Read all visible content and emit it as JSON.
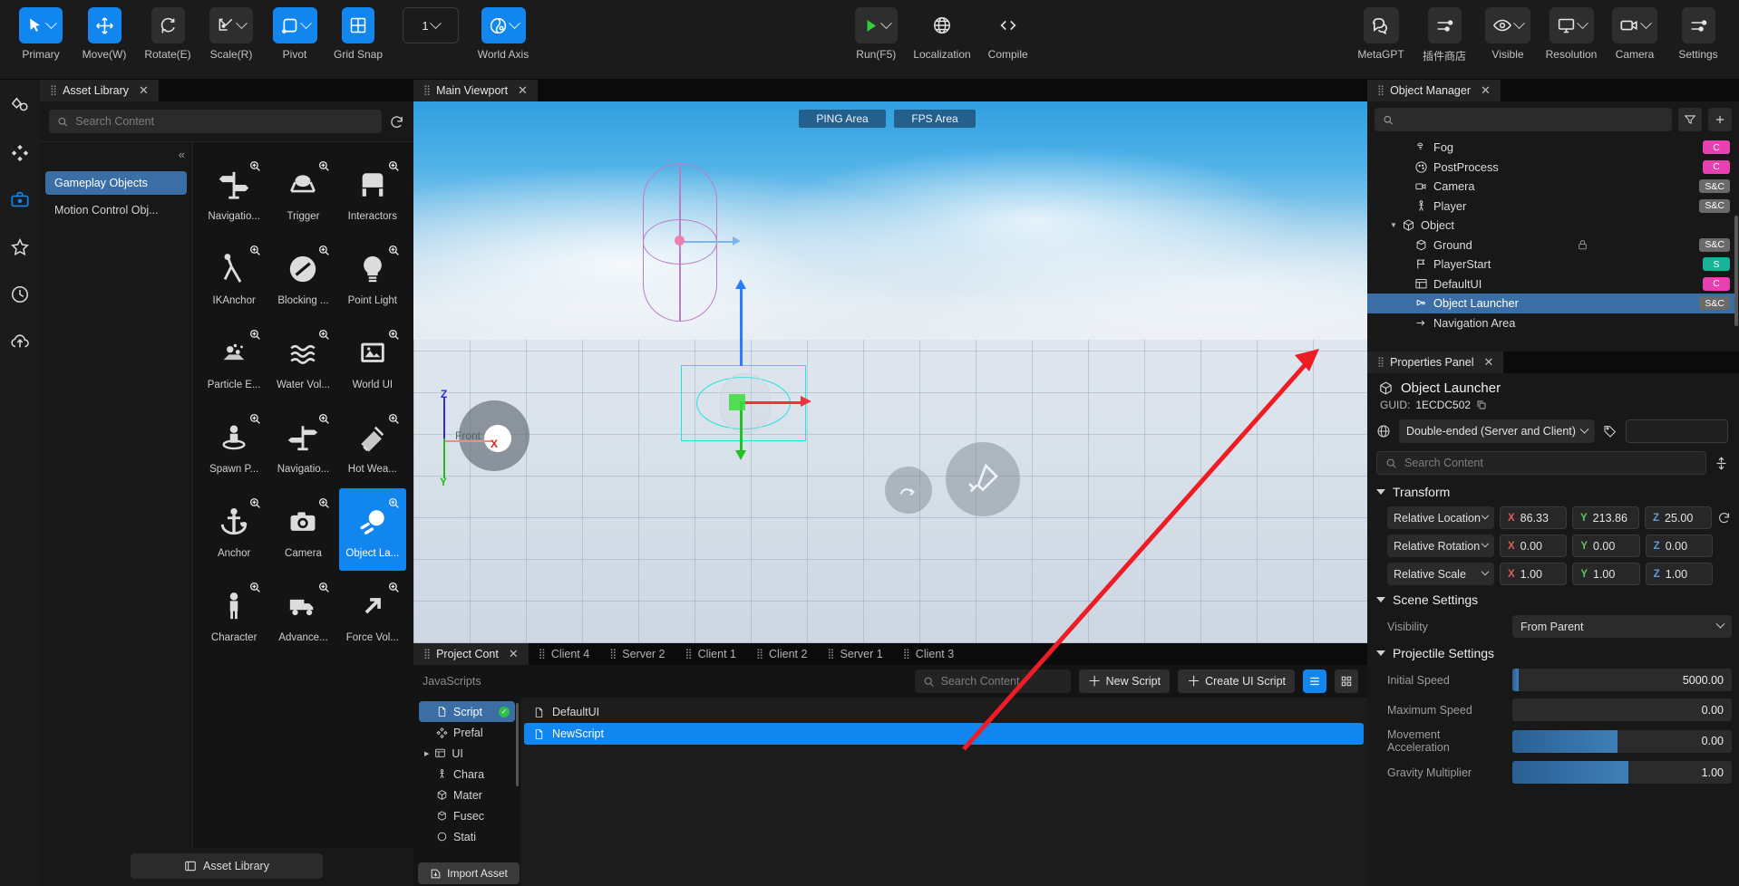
{
  "toolbar": {
    "left_items": [
      {
        "label": "Primary",
        "icon": "cursor-icon",
        "style": "accent",
        "chevron": true
      },
      {
        "label": "Move(W)",
        "icon": "move-icon",
        "style": "accent",
        "chevron": false
      },
      {
        "label": "Rotate(E)",
        "icon": "rotate-icon",
        "style": "dark",
        "chevron": false
      },
      {
        "label": "Scale(R)",
        "icon": "scale-icon",
        "style": "dark",
        "chevron": true
      },
      {
        "label": "Pivot",
        "icon": "pivot-icon",
        "style": "accent",
        "chevron": true
      },
      {
        "label": "Grid Snap",
        "icon": "grid-icon",
        "style": "accent",
        "chevron": false
      }
    ],
    "grid_value": "1",
    "world_axis": {
      "label": "World Axis",
      "icon": "globe-axis-icon"
    },
    "center_items": [
      {
        "label": "Run(F5)",
        "icon": "play-icon",
        "chevron": true
      },
      {
        "label": "Localization",
        "icon": "globe-icon",
        "chevron": false
      },
      {
        "label": "Compile",
        "icon": "code-icon",
        "chevron": false
      }
    ],
    "right_items": [
      {
        "label": "MetaGPT",
        "icon": "chat-bubbles-icon",
        "chevron": false
      },
      {
        "label": "插件商店",
        "icon": "sliders-icon",
        "chevron": false
      },
      {
        "label": "Visible",
        "icon": "eye-icon",
        "chevron": true
      },
      {
        "label": "Resolution",
        "icon": "monitor-icon",
        "chevron": true
      },
      {
        "label": "Camera",
        "icon": "video-icon",
        "chevron": true
      },
      {
        "label": "Settings",
        "icon": "sliders-icon",
        "chevron": false
      }
    ]
  },
  "left_rail": [
    {
      "name": "shapes-icon",
      "active": false
    },
    {
      "name": "diamond-grid-icon",
      "active": false
    },
    {
      "name": "toolbox-icon",
      "active": true
    },
    {
      "name": "star-icon",
      "active": false
    },
    {
      "name": "clock-icon",
      "active": false
    },
    {
      "name": "cloud-upload-icon",
      "active": false
    }
  ],
  "asset_library": {
    "tab_title": "Asset Library",
    "search_placeholder": "Search Content",
    "search_value": "",
    "categories": [
      {
        "label": "Gameplay Objects",
        "selected": true
      },
      {
        "label": "Motion Control Obj...",
        "selected": false
      }
    ],
    "assets": [
      {
        "label": "Navigatio...",
        "icon": "signpost-icon",
        "selected": false
      },
      {
        "label": "Trigger",
        "icon": "trigger-dome-icon",
        "selected": false
      },
      {
        "label": "Interactors",
        "icon": "chair-icon",
        "selected": false
      },
      {
        "label": "IKAnchor",
        "icon": "ik-anchor-icon",
        "selected": false
      },
      {
        "label": "Blocking ...",
        "icon": "no-entry-icon",
        "selected": false
      },
      {
        "label": "Point Light",
        "icon": "lightbulb-icon",
        "selected": false
      },
      {
        "label": "Particle E...",
        "icon": "particle-icon",
        "selected": false
      },
      {
        "label": "Water Vol...",
        "icon": "water-icon",
        "selected": false
      },
      {
        "label": "World UI",
        "icon": "image-ui-icon",
        "selected": false
      },
      {
        "label": "Spawn P...",
        "icon": "spawn-point-icon",
        "selected": false
      },
      {
        "label": "Navigatio...",
        "icon": "signpost-m-icon",
        "selected": false
      },
      {
        "label": "Hot Wea...",
        "icon": "hot-weapon-icon",
        "selected": false
      },
      {
        "label": "Anchor",
        "icon": "anchor-icon",
        "selected": false
      },
      {
        "label": "Camera",
        "icon": "camera-icon",
        "selected": false
      },
      {
        "label": "Object La...",
        "icon": "object-launcher-icon",
        "selected": true
      },
      {
        "label": "Character",
        "icon": "character-icon",
        "selected": false
      },
      {
        "label": "Advance...",
        "icon": "truck-icon",
        "selected": false
      },
      {
        "label": "Force Vol...",
        "icon": "force-arrow-icon",
        "selected": false
      }
    ],
    "footer_button": "Asset Library"
  },
  "viewport": {
    "tab_title": "Main Viewport",
    "badges": [
      "PING Area",
      "FPS Area"
    ],
    "axis_labels": {
      "x": "X",
      "y": "Y",
      "z": "Z",
      "front": "Front"
    }
  },
  "object_manager": {
    "tab_title": "Object Manager",
    "search_placeholder": "",
    "filter_icon": "filter-icon",
    "add_icon": "plus-icon",
    "items": [
      {
        "label": "Fog",
        "icon": "fog-icon",
        "indent": 2,
        "badge": "C",
        "badge_type": "c",
        "twisty": false,
        "selected": false
      },
      {
        "label": "PostProcess",
        "icon": "palette-icon",
        "indent": 2,
        "badge": "C",
        "badge_type": "c",
        "twisty": false,
        "selected": false
      },
      {
        "label": "Camera",
        "icon": "video-icon",
        "indent": 2,
        "badge": "S&C",
        "badge_type": "sc",
        "twisty": false,
        "selected": false
      },
      {
        "label": "Player",
        "icon": "person-icon",
        "indent": 2,
        "badge": "S&C",
        "badge_type": "sc",
        "twisty": false,
        "selected": false
      },
      {
        "label": "Object",
        "icon": "cube-icon",
        "indent": 1,
        "badge": "",
        "badge_type": "",
        "twisty": true,
        "selected": false
      },
      {
        "label": "Ground",
        "icon": "box-icon",
        "indent": 2,
        "badge": "S&C",
        "badge_type": "sc",
        "twisty": false,
        "selected": false,
        "lock": true
      },
      {
        "label": "PlayerStart",
        "icon": "flag-icon",
        "indent": 2,
        "badge": "S",
        "badge_type": "s",
        "twisty": false,
        "selected": false
      },
      {
        "label": "DefaultUI",
        "icon": "ui-icon",
        "indent": 2,
        "badge": "C",
        "badge_type": "c",
        "twisty": false,
        "selected": false
      },
      {
        "label": "Object Launcher",
        "icon": "launcher-icon",
        "indent": 2,
        "badge": "S&C",
        "badge_type": "sc",
        "twisty": false,
        "selected": true
      },
      {
        "label": "Navigation Area",
        "icon": "nav-area-icon",
        "indent": 2,
        "badge": "",
        "badge_type": "",
        "twisty": false,
        "selected": false
      }
    ]
  },
  "properties_panel": {
    "tab_title": "Properties Panel",
    "object_name": "Object Launcher",
    "guid_label": "GUID:",
    "guid_value": "1ECDC502",
    "network_mode": "Double-ended (Server and Client)",
    "tag_value": "",
    "search_placeholder": "Search Content",
    "sections": {
      "transform": {
        "title": "Transform",
        "rows": [
          {
            "label": "Relative Location",
            "x": "86.33",
            "y": "213.86",
            "z": "25.00",
            "reset": true
          },
          {
            "label": "Relative Rotation",
            "x": "0.00",
            "y": "0.00",
            "z": "0.00",
            "reset": false
          },
          {
            "label": "Relative Scale",
            "x": "1.00",
            "y": "1.00",
            "z": "1.00",
            "reset": false
          }
        ]
      },
      "scene_settings": {
        "title": "Scene Settings",
        "visibility_label": "Visibility",
        "visibility_value": "From Parent"
      },
      "projectile_settings": {
        "title": "Projectile Settings",
        "rows": [
          {
            "label": "Initial Speed",
            "value": "5000.00",
            "fill_pct": 3
          },
          {
            "label": "Maximum Speed",
            "value": "0.00",
            "fill_pct": 0
          },
          {
            "label": "Movement Acceleration",
            "value": "0.00",
            "fill_pct": 48
          },
          {
            "label": "Gravity Multiplier",
            "value": "1.00",
            "fill_pct": 53
          }
        ]
      }
    }
  },
  "bottom_panel": {
    "tabs": [
      {
        "label": "Project Cont",
        "active": true,
        "closable": true
      },
      {
        "label": "Client 4",
        "active": false,
        "closable": false
      },
      {
        "label": "Server 2",
        "active": false,
        "closable": false
      },
      {
        "label": "Client 1",
        "active": false,
        "closable": false
      },
      {
        "label": "Client 2",
        "active": false,
        "closable": false
      },
      {
        "label": "Server 1",
        "active": false,
        "closable": false
      },
      {
        "label": "Client 3",
        "active": false,
        "closable": false
      }
    ],
    "breadcrumb": "JavaScripts",
    "search_placeholder": "Search Content",
    "new_script_label": "New Script",
    "create_ui_script_label": "Create UI Script",
    "tree": [
      {
        "label": "Script",
        "icon": "file-icon",
        "selected": true,
        "check": true,
        "twisty": false
      },
      {
        "label": "Prefal",
        "icon": "prefab-icon",
        "selected": false,
        "check": false,
        "twisty": false
      },
      {
        "label": "UI",
        "icon": "ui-icon",
        "selected": false,
        "check": false,
        "twisty": true
      },
      {
        "label": "Chara",
        "icon": "person-icon",
        "selected": false,
        "check": false,
        "twisty": false
      },
      {
        "label": "Mater",
        "icon": "cube-icon",
        "selected": false,
        "check": false,
        "twisty": false
      },
      {
        "label": "Fusec",
        "icon": "box-icon",
        "selected": false,
        "check": false,
        "twisty": false
      },
      {
        "label": "Stati",
        "icon": "static-icon",
        "selected": false,
        "check": false,
        "twisty": false
      }
    ],
    "files": [
      {
        "label": "DefaultUI",
        "icon": "file-icon",
        "selected": false
      },
      {
        "label": "NewScript",
        "icon": "file-icon",
        "selected": true
      }
    ],
    "import_label": "Import Asset"
  },
  "colors": {
    "accent": "#1186ef",
    "select": "#3b6ea5",
    "badge_c": "#e83fb1",
    "badge_s": "#18b396",
    "badge_sc": "#6a6a6a",
    "annotation_arrow": "#ee1c25"
  }
}
